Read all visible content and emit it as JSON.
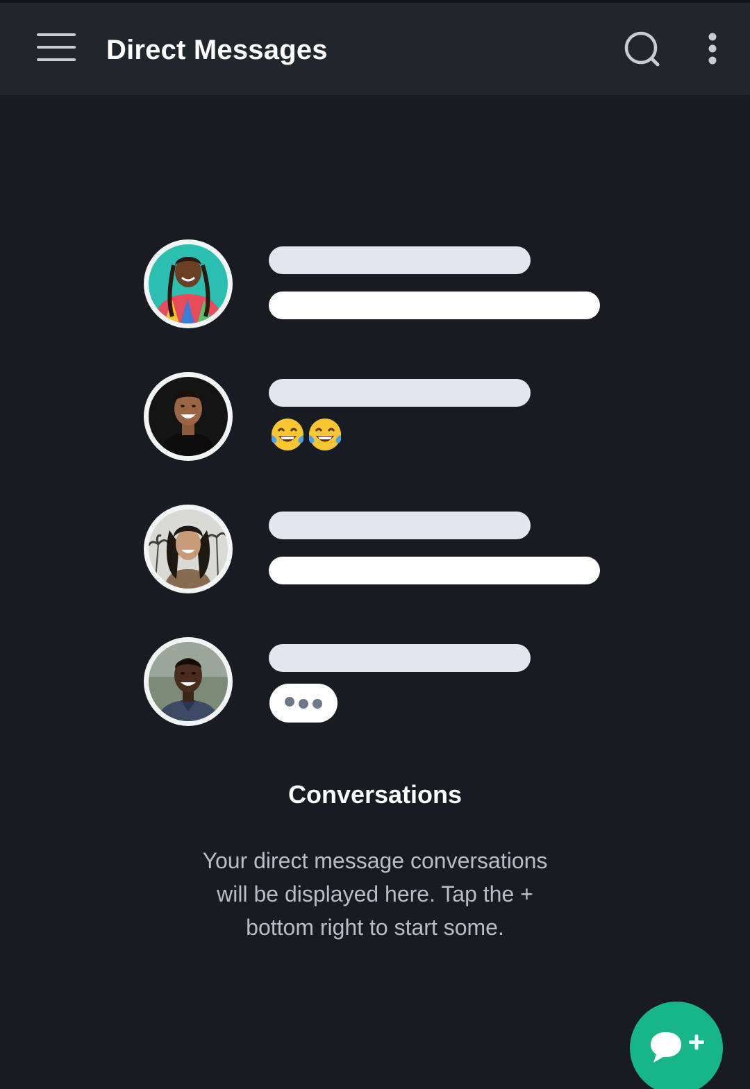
{
  "app_bar": {
    "title": "Direct Messages",
    "menu_icon": "hamburger-menu-icon",
    "search_icon": "search-icon",
    "more_icon": "more-vertical-icon",
    "background": "#21252c"
  },
  "illustration": {
    "rows": [
      {
        "avatar": "avatar-woman-colorful-shirt",
        "message_type": "text-placeholder"
      },
      {
        "avatar": "avatar-man-laughing",
        "message_type": "emoji",
        "emoji": "😂😂"
      },
      {
        "avatar": "avatar-woman-smiling-palms",
        "message_type": "text-placeholder"
      },
      {
        "avatar": "avatar-man-smiling",
        "message_type": "typing-indicator"
      }
    ]
  },
  "empty_state": {
    "heading": "Conversations",
    "body": "Your direct message conversations will be displayed here. Tap the + bottom right to start some."
  },
  "fab": {
    "icon": "new-message-icon",
    "color": "#17b58a"
  },
  "colors": {
    "background": "#181b21",
    "placeholder_name": "#e3e6ee",
    "placeholder_message": "#ffffff",
    "body_text": "#b9bdc6"
  }
}
